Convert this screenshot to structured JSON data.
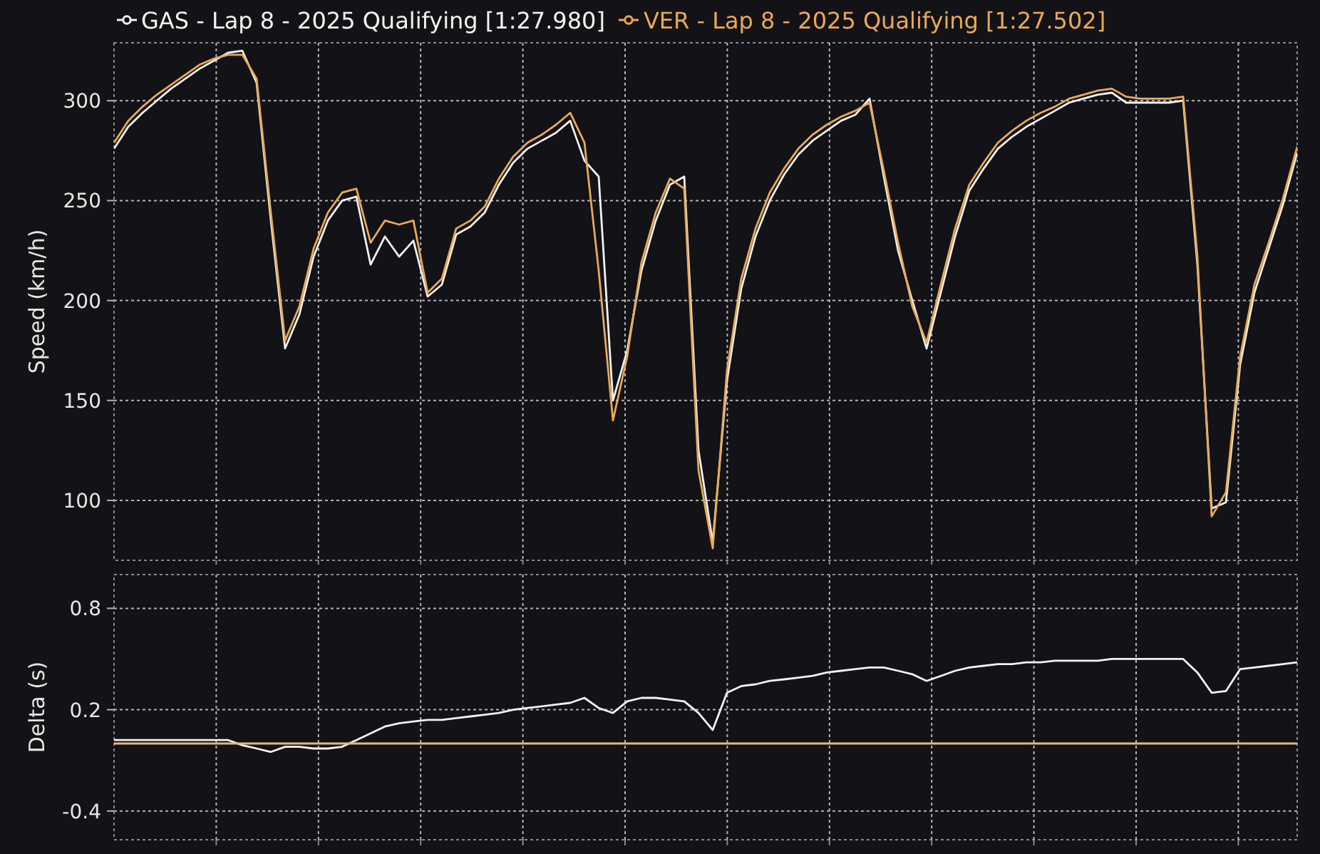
{
  "speed_panel": {
    "chart_data": {
      "type": "line",
      "grid": true,
      "ylabel": "Speed (km/h)",
      "ylim": [
        70,
        329
      ],
      "yticks": [
        100,
        150,
        200,
        250,
        300
      ],
      "series": [
        {
          "name": "GAS - Lap 8 - 2025 Qualifying [1:27.980]",
          "color": "#f2f2f2",
          "values": [
            276,
            287,
            294,
            300,
            306,
            311,
            316,
            320,
            324,
            325,
            309,
            240,
            176,
            193,
            222,
            240,
            250,
            252,
            218,
            232,
            222,
            230,
            202,
            208,
            233,
            237,
            244,
            258,
            269,
            276,
            280,
            284,
            290,
            270,
            262,
            150,
            175,
            215,
            240,
            258,
            262,
            125,
            79,
            160,
            206,
            232,
            250,
            263,
            273,
            280,
            285,
            290,
            293,
            301,
            262,
            225,
            200,
            176,
            204,
            232,
            255,
            266,
            276,
            282,
            287,
            291,
            295,
            299,
            301,
            303,
            304,
            299,
            299,
            299,
            299,
            300,
            218,
            96,
            99,
            168,
            204,
            226,
            248,
            274
          ]
        },
        {
          "name": "VER - Lap 8 - 2025 Qualifying [1:27.502]",
          "color": "#e9a955",
          "values": [
            279,
            290,
            297,
            303,
            308,
            313,
            318,
            321,
            323,
            323,
            311,
            244,
            180,
            197,
            226,
            244,
            254,
            256,
            229,
            240,
            238,
            240,
            204,
            211,
            236,
            240,
            247,
            261,
            272,
            279,
            283,
            288,
            294,
            279,
            215,
            140,
            172,
            219,
            244,
            261,
            256,
            115,
            76,
            165,
            211,
            236,
            254,
            266,
            276,
            283,
            288,
            292,
            295,
            299,
            265,
            229,
            197,
            179,
            208,
            236,
            258,
            269,
            279,
            285,
            290,
            294,
            297,
            301,
            303,
            305,
            306,
            302,
            301,
            301,
            301,
            302,
            222,
            92,
            104,
            172,
            208,
            229,
            251,
            277
          ]
        }
      ]
    }
  },
  "delta_panel": {
    "chart_data": {
      "type": "line",
      "grid": true,
      "ylabel": "Delta (s)",
      "ylim": [
        -0.57,
        1.0
      ],
      "yticks": [
        0.8,
        0.2,
        -0.4
      ],
      "series": [
        {
          "color": "#f2f2f2",
          "values": [
            0.02,
            0.02,
            0.02,
            0.02,
            0.02,
            0.02,
            0.02,
            0.02,
            0.02,
            -0.01,
            -0.03,
            -0.05,
            -0.02,
            -0.02,
            -0.03,
            -0.03,
            -0.02,
            0.02,
            0.06,
            0.1,
            0.12,
            0.13,
            0.14,
            0.14,
            0.15,
            0.16,
            0.17,
            0.18,
            0.2,
            0.21,
            0.22,
            0.23,
            0.24,
            0.27,
            0.21,
            0.18,
            0.25,
            0.27,
            0.27,
            0.26,
            0.25,
            0.18,
            0.08,
            0.3,
            0.34,
            0.35,
            0.37,
            0.38,
            0.39,
            0.4,
            0.42,
            0.43,
            0.44,
            0.45,
            0.45,
            0.43,
            0.41,
            0.37,
            0.4,
            0.43,
            0.45,
            0.46,
            0.47,
            0.47,
            0.48,
            0.48,
            0.49,
            0.49,
            0.49,
            0.49,
            0.5,
            0.5,
            0.5,
            0.5,
            0.5,
            0.5,
            0.42,
            0.3,
            0.31,
            0.44,
            0.45,
            0.46,
            0.47,
            0.48
          ]
        },
        {
          "color": "#e8b77a",
          "values": [
            0,
            0,
            0,
            0,
            0,
            0,
            0,
            0,
            0,
            0,
            0,
            0,
            0,
            0,
            0,
            0,
            0,
            0,
            0,
            0,
            0,
            0,
            0,
            0,
            0,
            0,
            0,
            0,
            0,
            0,
            0,
            0,
            0,
            0,
            0,
            0,
            0,
            0,
            0,
            0,
            0,
            0,
            0,
            0,
            0,
            0,
            0,
            0,
            0,
            0,
            0,
            0,
            0,
            0,
            0,
            0,
            0,
            0,
            0,
            0,
            0,
            0,
            0,
            0,
            0,
            0,
            0,
            0,
            0,
            0,
            0,
            0,
            0,
            0,
            0,
            0,
            0,
            0,
            0,
            0,
            0,
            0,
            0,
            0
          ]
        }
      ]
    }
  }
}
